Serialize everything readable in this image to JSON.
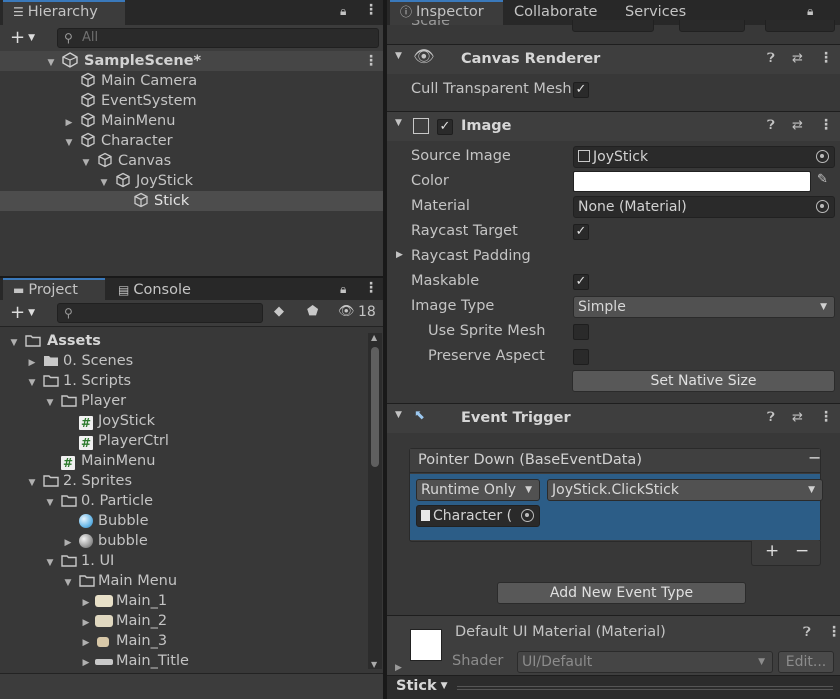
{
  "hierarchy": {
    "tab": "Hierarchy",
    "search_placeholder": "All",
    "scene": "SampleScene*",
    "items": [
      "Main Camera",
      "EventSystem",
      "MainMenu",
      "Character",
      "Canvas",
      "JoyStick",
      "Stick"
    ]
  },
  "inspector_tabs": [
    "Inspector",
    "Collaborate",
    "Services"
  ],
  "project": {
    "tabs": [
      "Project",
      "Console"
    ],
    "hidden_count": "18",
    "tree": [
      "Assets",
      "0. Scenes",
      "1. Scripts",
      "Player",
      "JoyStick",
      "PlayerCtrl",
      "MainMenu",
      "2. Sprites",
      "0. Particle",
      "Bubble",
      "bubble",
      "1. UI",
      "Main Menu",
      "Main_1",
      "Main_2",
      "Main_3",
      "Main_Title"
    ]
  },
  "inspector": {
    "top_cut": "Scale",
    "canvas_renderer": {
      "title": "Canvas Renderer",
      "cull_label": "Cull Transparent Mesh"
    },
    "image": {
      "title": "Image",
      "source_image_label": "Source Image",
      "source_image_value": "JoyStick",
      "color_label": "Color",
      "material_label": "Material",
      "material_value": "None (Material)",
      "raycast_target_label": "Raycast Target",
      "raycast_padding_label": "Raycast Padding",
      "maskable_label": "Maskable",
      "image_type_label": "Image Type",
      "image_type_value": "Simple",
      "use_sprite_mesh_label": "Use Sprite Mesh",
      "preserve_aspect_label": "Preserve Aspect",
      "set_native_size": "Set Native Size"
    },
    "event_trigger": {
      "title": "Event Trigger",
      "entry_title": "Pointer Down (BaseEventData)",
      "runtime": "Runtime Only",
      "function": "JoyStick.ClickStick",
      "target": "Character (",
      "add_button": "Add New Event Type"
    },
    "material": {
      "name": "Default UI Material (Material)",
      "shader_label": "Shader",
      "shader_value": "UI/Default",
      "edit": "Edit..."
    },
    "footer_object": "Stick"
  },
  "colors": {
    "accent": "#3a79bb",
    "selection": "#2c5d87",
    "panel": "#383838"
  }
}
